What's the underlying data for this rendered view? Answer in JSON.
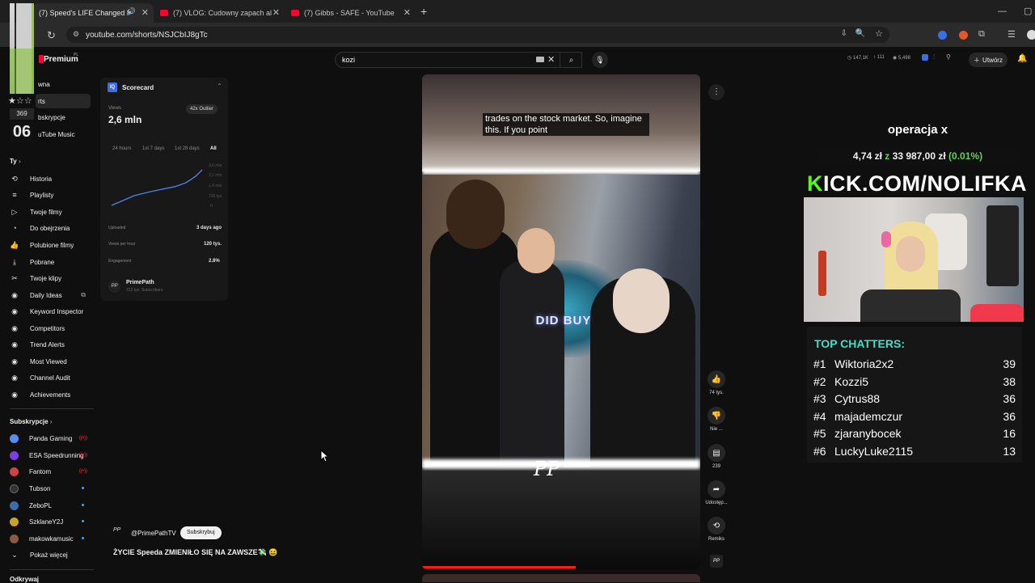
{
  "browser": {
    "tabs": [
      {
        "label": "(7) Speed's LIFE Changed F",
        "active": true
      },
      {
        "label": "(7) VLOG: Cudowny zapach al",
        "active": false
      },
      {
        "label": "(7) Gibbs - SAFE - YouTube",
        "active": false
      }
    ],
    "url": "youtube.com/shorts/NSJCbIJ8gTc",
    "new_tab": "+"
  },
  "overlay_left": {
    "count": "369",
    "big": "06"
  },
  "header": {
    "brand": "Premium",
    "brand_sup": "PL",
    "search_value": "kozi",
    "stats": [
      "147,1K",
      "111",
      "5,498"
    ],
    "create_label": "Utwórz"
  },
  "sidebar": {
    "top": [
      "wna",
      "rts",
      "bskrypcje",
      "uTube Music"
    ],
    "you_label": "Ty",
    "you_items": [
      {
        "label": "Historia",
        "icon": "history-icon"
      },
      {
        "label": "Playlisty",
        "icon": "playlist-icon"
      },
      {
        "label": "Twoje filmy",
        "icon": "video-icon"
      },
      {
        "label": "Do obejrzenia",
        "icon": "clock-icon"
      },
      {
        "label": "Polubione filmy",
        "icon": "like-icon"
      },
      {
        "label": "Pobrane",
        "icon": "download-icon"
      },
      {
        "label": "Twoje klipy",
        "icon": "scissors-icon"
      },
      {
        "label": "Daily Ideas",
        "icon": "tool-icon"
      },
      {
        "label": "Keyword Inspector",
        "icon": "tool-icon"
      },
      {
        "label": "Competitors",
        "icon": "tool-icon"
      },
      {
        "label": "Trend Alerts",
        "icon": "tool-icon"
      },
      {
        "label": "Most Viewed",
        "icon": "tool-icon"
      },
      {
        "label": "Channel Audit",
        "icon": "tool-icon"
      },
      {
        "label": "Achievements",
        "icon": "tool-icon"
      }
    ],
    "subs_label": "Subskrypcje",
    "subs": [
      {
        "label": "Panda Gaming",
        "color": "#5b8def"
      },
      {
        "label": "ESA Speedrunning",
        "color": "#7b3fe4"
      },
      {
        "label": "Fantom",
        "color": "#cc4444"
      },
      {
        "label": "Tubson",
        "color": "#333333"
      },
      {
        "label": "ZeboPL",
        "color": "#3a6ea5"
      },
      {
        "label": "SzklaneY2J",
        "color": "#c9a227"
      },
      {
        "label": "makowkamusic",
        "color": "#8a5a44"
      }
    ],
    "show_more": "Pokaż więcej",
    "explore": "Odkrywaj"
  },
  "scorecard": {
    "title": "Scorecard",
    "views_label": "Views",
    "views_value": "2,6 mln",
    "outlier": "42x Outlier",
    "ranges": [
      "24 hours",
      "1st 7 days",
      "1st 28 days",
      "All"
    ],
    "yticks": [
      "3,6 mln",
      "2,1 mln",
      "1,4 mln",
      "700 tys.",
      "0"
    ],
    "rows": [
      {
        "label": "Uploaded",
        "value": "3 days ago"
      },
      {
        "label": "Views per hour",
        "value": "120 tys."
      },
      {
        "label": "Engagement",
        "value": "2.8%"
      }
    ],
    "channel": "PrimePath",
    "channel_subs": "312 tys. Subscribers"
  },
  "video": {
    "caption": "trades on the stock market. So, imagine this. If you point",
    "overlay_text": "DID BUY",
    "signature": "PP",
    "channel_handle": "@PrimePathTV",
    "subscribe": "Subskrybuj",
    "title": "ŻYCIE Speeda ZMIENIŁO SIĘ NA ZAWSZE💸 😆",
    "actions": [
      {
        "icon": "thumbs-up-icon",
        "label": "74 tys."
      },
      {
        "icon": "thumbs-down-icon",
        "label": "Nie ..."
      },
      {
        "icon": "comment-icon",
        "label": "239"
      },
      {
        "icon": "share-icon",
        "label": "Udostęp..."
      },
      {
        "icon": "remix-icon",
        "label": "Remiks"
      }
    ]
  },
  "stream": {
    "title": "operacja x",
    "progress_current": "4,74 zł",
    "progress_z": "z",
    "progress_goal": "33 987,00 zł",
    "progress_pct": "(0.01%)",
    "kick": "KICK.COM/NOLIFKA",
    "chat_title": "TOP CHATTERS:",
    "chatters": [
      {
        "rank": "#1",
        "name": "Wiktoria2x2",
        "count": "39"
      },
      {
        "rank": "#2",
        "name": "Kozzi5",
        "count": "38"
      },
      {
        "rank": "#3",
        "name": "Cytrus88",
        "count": "36"
      },
      {
        "rank": "#4",
        "name": "majademczur",
        "count": "36"
      },
      {
        "rank": "#5",
        "name": "zjaranybocek",
        "count": "16"
      },
      {
        "rank": "#6",
        "name": "LuckyLuke2115",
        "count": "13"
      }
    ]
  }
}
